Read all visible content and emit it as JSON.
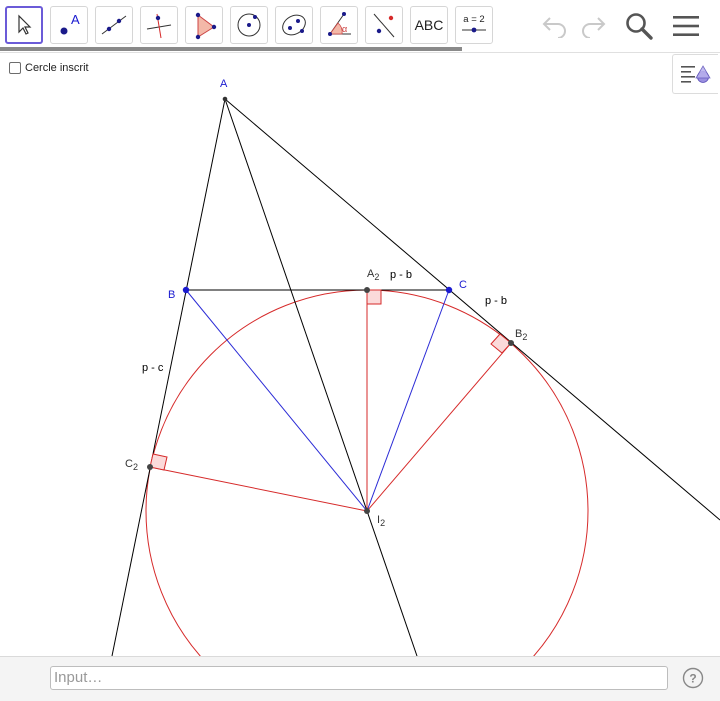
{
  "toolbar": {
    "tools": [
      {
        "name": "move-tool",
        "icon": "cursor-icon"
      },
      {
        "name": "point-tool",
        "icon": "point-icon",
        "label": "A"
      },
      {
        "name": "line-tool",
        "icon": "line-icon"
      },
      {
        "name": "perpendicular-line-tool",
        "icon": "perpendicular-icon"
      },
      {
        "name": "polygon-tool",
        "icon": "polygon-icon"
      },
      {
        "name": "circle-tool",
        "icon": "circle-icon"
      },
      {
        "name": "ellipse-tool",
        "icon": "ellipse-icon"
      },
      {
        "name": "angle-tool",
        "icon": "angle-icon",
        "label": "α"
      },
      {
        "name": "reflect-tool",
        "icon": "reflect-icon"
      },
      {
        "name": "text-tool",
        "icon": "text-icon",
        "label": "ABC"
      },
      {
        "name": "slider-tool",
        "icon": "slider-icon",
        "label": "a = 2"
      }
    ],
    "right_icons": [
      "undo-icon",
      "redo-icon",
      "search-icon",
      "menu-icon"
    ]
  },
  "checkbox": {
    "label": "Cercle inscrit",
    "checked": false
  },
  "labels": {
    "A": "A",
    "B": "B",
    "C": "C",
    "A2": "A",
    "A2_sub": "2",
    "B2": "B",
    "B2_sub": "2",
    "C2": "C",
    "C2_sub": "2",
    "I2": "I",
    "I2_sub": "2",
    "seg_top": "p - b",
    "seg_right": "p - b",
    "seg_left": "p - c"
  },
  "input": {
    "placeholder": "Input…"
  },
  "colors": {
    "accent": "#6b5bd8",
    "circle": "#d62a2a",
    "bisector": "#2b2bd6",
    "point_blue": "#1a1ad0",
    "black": "#000000"
  }
}
